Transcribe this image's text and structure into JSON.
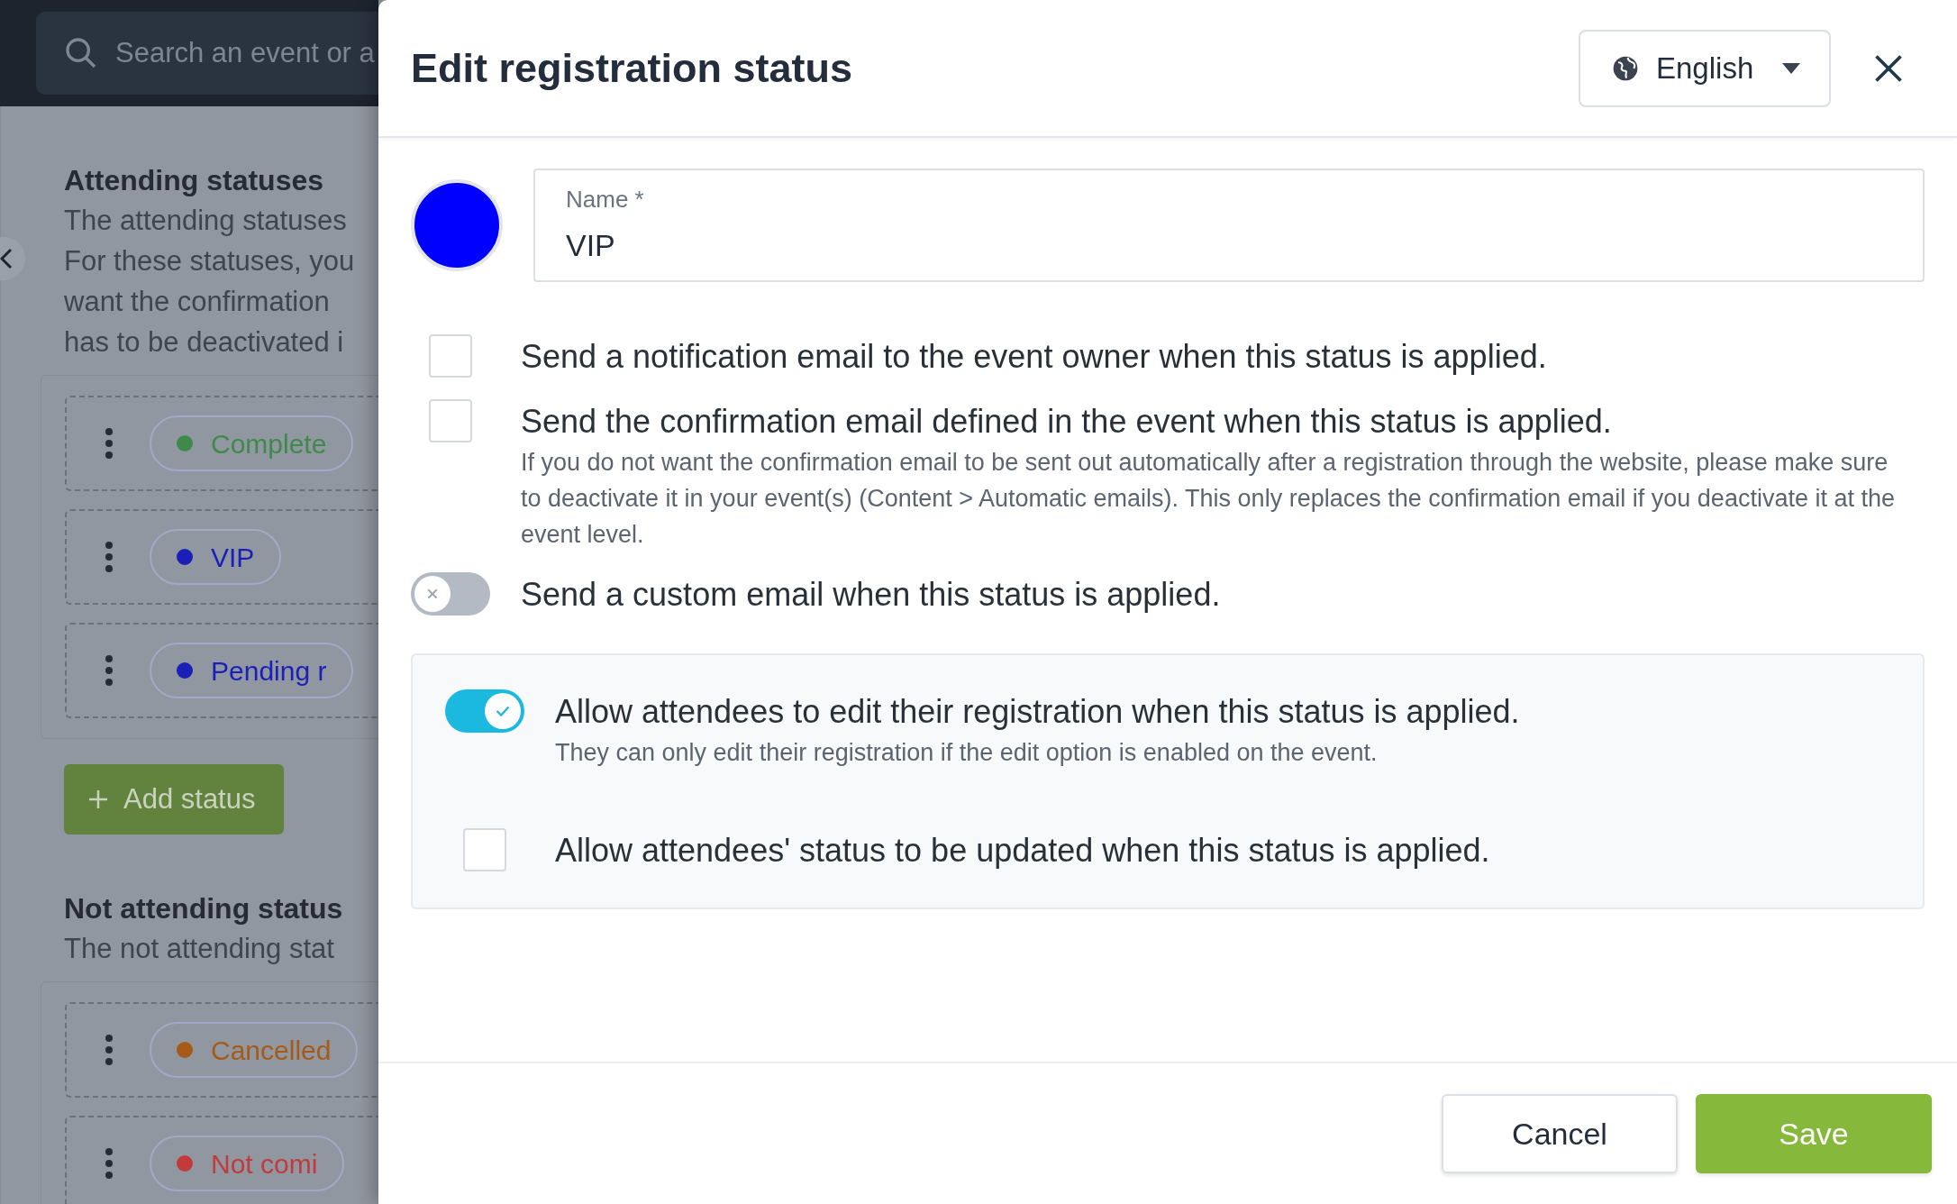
{
  "background_page": {
    "search": {
      "placeholder": "Search an event or a"
    },
    "sections": [
      {
        "title": "Attending statuses",
        "description_lines": [
          "The attending statuses",
          "For these statuses, you",
          "want the confirmation",
          "has to be deactivated i"
        ],
        "statuses": [
          {
            "label": "Complete",
            "color": "#3f8a4a"
          },
          {
            "label": "VIP",
            "color": "#1a1fb8"
          },
          {
            "label": "Pending r",
            "color": "#1a1fb8"
          }
        ],
        "add_button": "Add status"
      },
      {
        "title": "Not attending status",
        "description_lines": [
          "The not attending stat"
        ],
        "statuses": [
          {
            "label": "Cancelled",
            "color": "#a65a18"
          },
          {
            "label": "Not comi",
            "color": "#c23a3a"
          }
        ]
      }
    ]
  },
  "dialog": {
    "title": "Edit registration status",
    "language": "English",
    "swatch": {
      "color": "#0000ff"
    },
    "name_field": {
      "label": "Name *",
      "value": "VIP"
    },
    "options": [
      {
        "kind": "checkbox",
        "label": "Send a notification email to the event owner when this status is applied.",
        "checked": false
      },
      {
        "kind": "checkbox",
        "label": "Send the confirmation email defined in the event when this status is applied.",
        "checked": false,
        "help": "If you do not want the confirmation email to be sent out automatically after a registration through the website, please make sure to deactivate it in your event(s) (Content > Automatic emails). This only replaces the confirmation email if you deactivate it at the event level."
      },
      {
        "kind": "toggle",
        "label": "Send a custom email when this status is applied.",
        "on": false
      }
    ],
    "attendee_options": [
      {
        "kind": "toggle",
        "label": "Allow attendees to edit their registration when this status is applied.",
        "on": true,
        "help": "They can only edit their registration if the edit option is enabled on the event."
      },
      {
        "kind": "checkbox",
        "label": "Allow attendees' status to be updated when this status is applied.",
        "checked": false
      }
    ],
    "buttons": [
      {
        "kind": "secondary",
        "label": "Cancel"
      },
      {
        "kind": "primary",
        "label": "Save"
      }
    ]
  }
}
